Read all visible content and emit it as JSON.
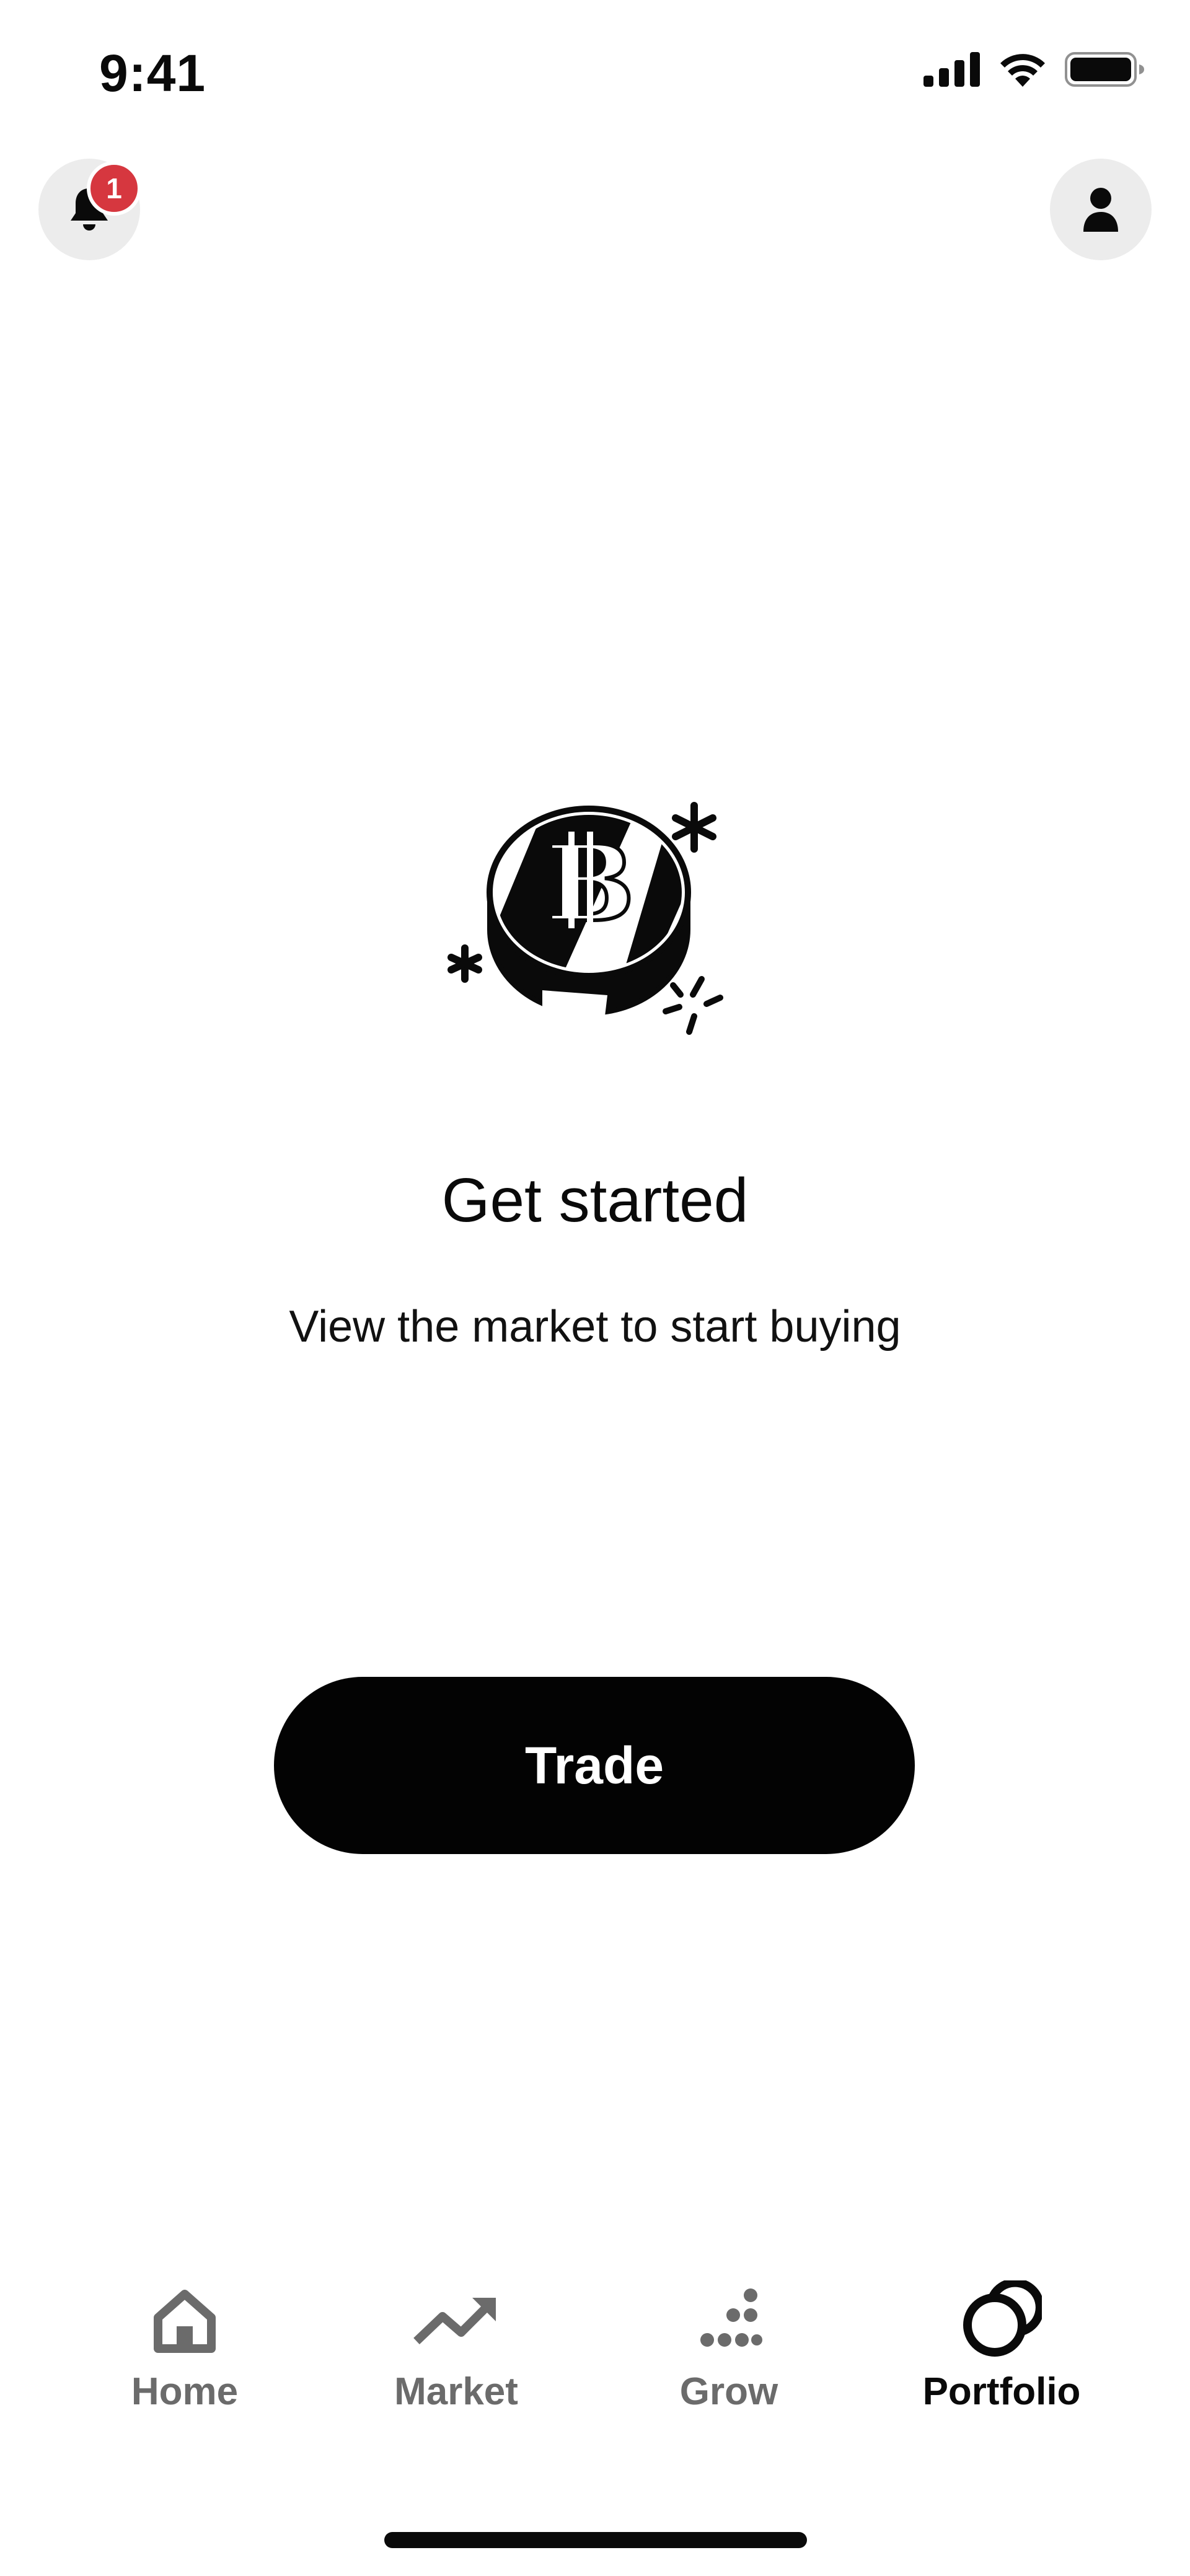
{
  "status_bar": {
    "time": "9:41",
    "icons": [
      "signal-icon",
      "wifi-icon",
      "battery-icon"
    ]
  },
  "header": {
    "notifications": {
      "icon": "bell-icon",
      "badge_count": "1",
      "badge_color": "#d6373f"
    },
    "profile": {
      "icon": "person-icon"
    }
  },
  "empty_state": {
    "illustration": "bitcoin-coin-icon",
    "title": "Get started",
    "subtitle": "View the market to start buying"
  },
  "primary_action": {
    "label": "Trade",
    "color": "#030303"
  },
  "tab_bar": {
    "active": "Portfolio",
    "tabs": [
      {
        "label": "Home",
        "icon": "home-icon"
      },
      {
        "label": "Market",
        "icon": "trend-up-icon"
      },
      {
        "label": "Grow",
        "icon": "grow-dots-icon"
      },
      {
        "label": "Portfolio",
        "icon": "portfolio-circles-icon"
      }
    ]
  }
}
